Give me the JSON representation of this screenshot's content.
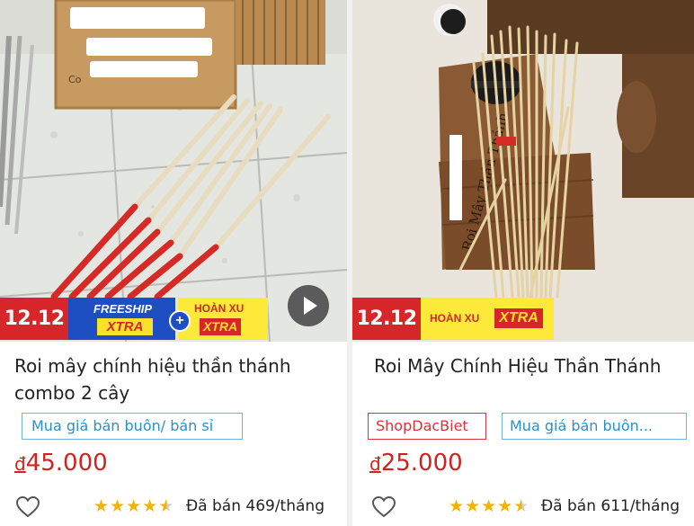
{
  "products": [
    {
      "title": "Roi mây chính hiệu thần thánh combo 2 cây",
      "photo_text": "Co",
      "badge_event": "12.12",
      "promo": {
        "freeship": "FREESHIP",
        "freeship_xtra": "XTRA",
        "hoanxu": "HOÀN XU",
        "hoanxu_xtra": "XTRA",
        "plus": "+"
      },
      "tags": [
        "Mua giá bán buôn/ bán sỉ"
      ],
      "currency": "đ",
      "price": "45.000",
      "rating": 4.5,
      "sold": "Đã bán 469/tháng",
      "icons": [
        "play-icon",
        "heart-icon",
        "star-icon"
      ]
    },
    {
      "title": "Roi Mây Chính Hiệu Thần Thánh",
      "photo_text": "Roi Mây Thần Thánh",
      "badge_event": "12.12",
      "promo": {
        "hoanxu": "HOÀN XU",
        "hoanxu_xtra": "XTRA"
      },
      "shop_tag": "ShopDacBiet",
      "tags": [
        "Mua giá bán buôn..."
      ],
      "currency": "đ",
      "price": "25.000",
      "rating": 4.5,
      "sold": "Đã bán 611/tháng",
      "icons": [
        "heart-icon",
        "star-icon"
      ]
    }
  ],
  "colors": {
    "price": "#d0231f",
    "badge_red": "#d7262a",
    "freeship_blue": "#1d4fc2",
    "xtra_yellow": "#fde93a",
    "tag_blue": "#2a8fc9",
    "star": "#f5b301"
  }
}
